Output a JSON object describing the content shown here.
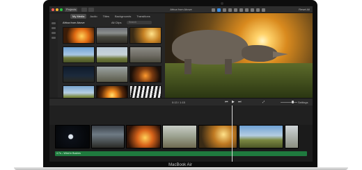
{
  "device": {
    "brand_label": "MacBook Air"
  },
  "toolbar": {
    "projects_label": "Projects",
    "window_title": "Africa from Above",
    "reset_label": "Reset All"
  },
  "browser": {
    "tabs": [
      {
        "label": "My Media",
        "active": true
      },
      {
        "label": "Audio",
        "active": false
      },
      {
        "label": "Titles",
        "active": false
      },
      {
        "label": "Backgrounds",
        "active": false
      },
      {
        "label": "Transitions",
        "active": false
      }
    ],
    "library_title": "Africa from Above",
    "filter_label": "All Clips",
    "search_placeholder": "Search",
    "thumbnails": [
      "fire-clip",
      "landscape-clip",
      "rhino-sunset-clip",
      "savanna-clip",
      "acacia-tree-clip",
      "rhino-clip",
      "night-sky-clip",
      "rider-clip",
      "campfire-clip",
      "grassland-clip",
      "sunset-clip",
      "zebra-clip"
    ]
  },
  "playback": {
    "timecode": "0:13 / 1:15",
    "settings_label": "Settings"
  },
  "timeline": {
    "clips": [
      "moon-clip",
      "jeep-clip",
      "fire-clip",
      "tree-clip",
      "rhino-clip",
      "herd-clip",
      "partial-clip"
    ],
    "audio_label": "4.7s – Wind in Bushes"
  },
  "colors": {
    "accent": "#3a8ee6",
    "audio_track": "#1f7a3e",
    "ui_dark": "#1e1e1e"
  }
}
